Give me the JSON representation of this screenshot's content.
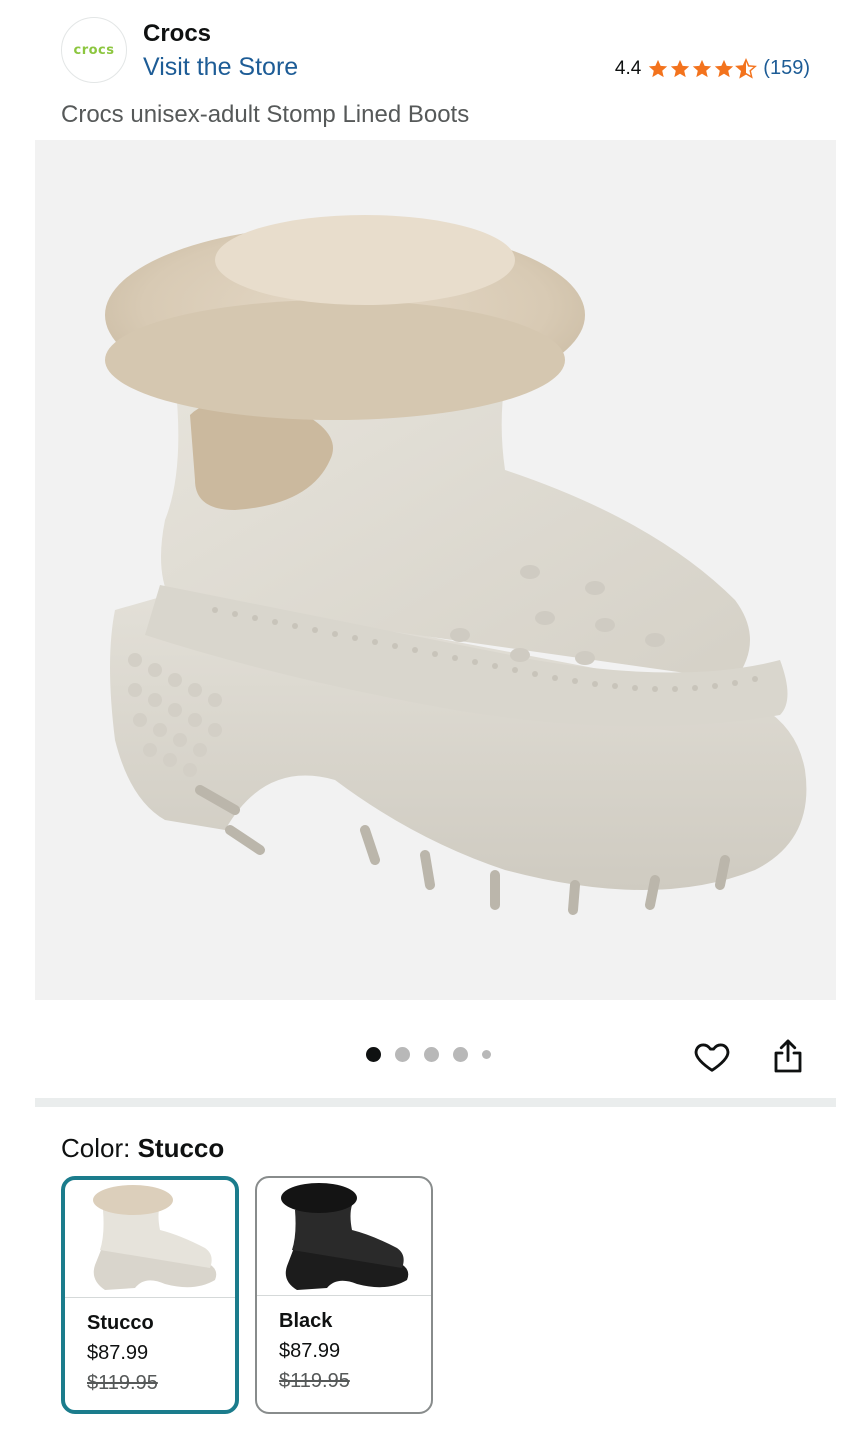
{
  "brand": {
    "logo_text": "crocs",
    "name": "Crocs",
    "visit_store": "Visit the Store",
    "accent_color": "#8cc63f"
  },
  "rating": {
    "value": "4.4",
    "stars": 4.4,
    "count": "(159)",
    "star_color": "#f3731d"
  },
  "product": {
    "title": "Crocs unisex-adult Stomp Lined Boots"
  },
  "gallery": {
    "image_count": 5,
    "active_index": 0,
    "icons": [
      "heart-icon",
      "share-icon"
    ]
  },
  "color": {
    "label": "Color: ",
    "selected": "Stucco",
    "options": [
      {
        "name": "Stucco",
        "price": "$87.99",
        "list_price": "$119.95",
        "selected": true
      },
      {
        "name": "Black",
        "price": "$87.99",
        "list_price": "$119.95",
        "selected": false
      }
    ],
    "selected_border_color": "#1b7c8c"
  }
}
